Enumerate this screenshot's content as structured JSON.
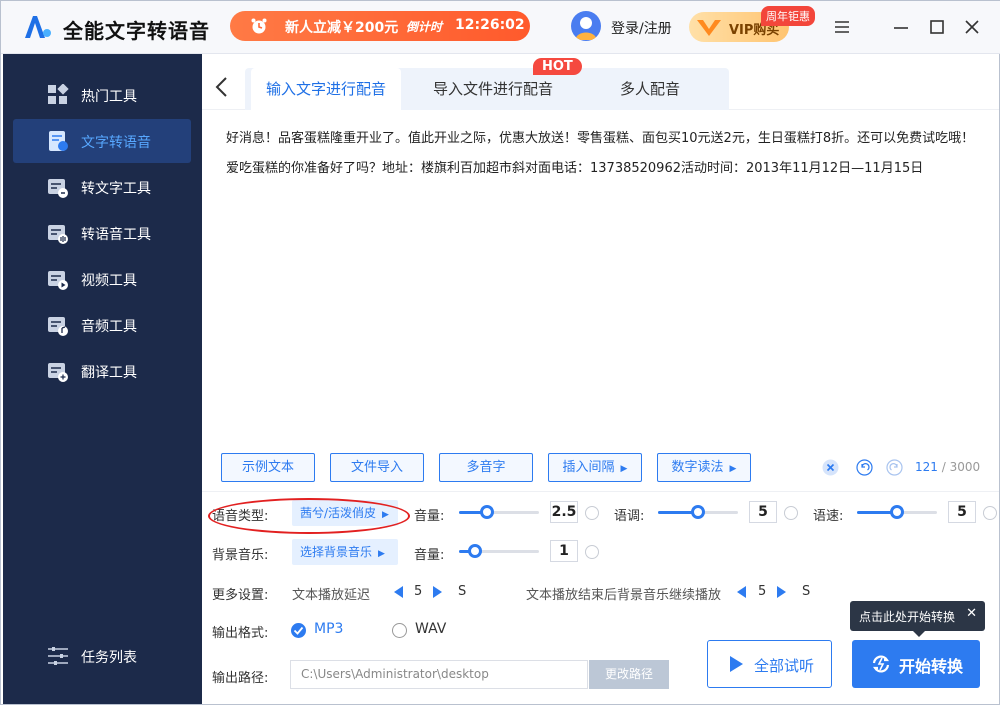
{
  "app": {
    "title": "全能文字转语音"
  },
  "promo": {
    "text": "新人立减￥200元",
    "countdown_label": "倒计时",
    "countdown": "12:26:02"
  },
  "user": {
    "login": "登录/注册"
  },
  "vip": {
    "label": "VIP购买",
    "badge": "周年钜惠"
  },
  "colors": {
    "accent": "#2d7bf0",
    "sidebar": "#1c2a4a",
    "hot": "#f5493f",
    "promo": "#ff6a3a"
  },
  "sidebar": {
    "items": [
      {
        "label": "热门工具",
        "icon": "grid-icon"
      },
      {
        "label": "文字转语音",
        "icon": "text-to-speech-icon",
        "active": true
      },
      {
        "label": "转文字工具",
        "icon": "to-text-icon"
      },
      {
        "label": "转语音工具",
        "icon": "to-speech-icon"
      },
      {
        "label": "视频工具",
        "icon": "video-icon"
      },
      {
        "label": "音频工具",
        "icon": "audio-icon"
      },
      {
        "label": "翻译工具",
        "icon": "translate-icon"
      }
    ],
    "task_list": "任务列表"
  },
  "tabs": [
    {
      "label": "输入文字进行配音",
      "active": true
    },
    {
      "label": "导入文件进行配音"
    },
    {
      "label": "多人配音"
    }
  ],
  "hot_badge": "HOT",
  "content": {
    "text": "好消息！品客蛋糕隆重开业了。值此开业之际，优惠大放送！零售蛋糕、面包买10元送2元，生日蛋糕打8折。还可以免费试吃哦！爱吃蛋糕的你准备好了吗？地址：楼旗利百加超市斜对面电话：13738520962活动时间：2013年11月12日—11月15日"
  },
  "toolbar": {
    "sample": "示例文本",
    "import": "文件导入",
    "polyphone": "多音字",
    "insert_pause": "插入间隔",
    "number_reading": "数字读法",
    "char_count": "121",
    "char_max": "/ 3000"
  },
  "voice": {
    "label": "语音类型:",
    "value": "茜兮/活泼俏皮",
    "volume_label": "音量:",
    "volume": "2.5",
    "volume_fraction": 0.35,
    "tone_label": "语调:",
    "tone": "5",
    "tone_fraction": 0.5,
    "speed_label": "语速:",
    "speed": "5",
    "speed_fraction": 0.5
  },
  "bgm": {
    "label": "背景音乐:",
    "value": "选择背景音乐",
    "volume_label": "音量:",
    "volume": "1",
    "volume_fraction": 0.2
  },
  "more": {
    "label": "更多设置:",
    "delay_label": "文本播放延迟",
    "delay": "5",
    "delay_unit": "S",
    "after_label": "文本播放结束后背景音乐继续播放",
    "after": "5",
    "after_unit": "S"
  },
  "format": {
    "label": "输出格式:",
    "mp3": "MP3",
    "wav": "WAV",
    "selected": "MP3"
  },
  "output": {
    "label": "输出路径:",
    "path": "C:\\Users\\Administrator\\desktop",
    "change": "更改路径"
  },
  "actions": {
    "trial": "全部试听",
    "start": "开始转换",
    "tooltip": "点击此处开始转换"
  }
}
